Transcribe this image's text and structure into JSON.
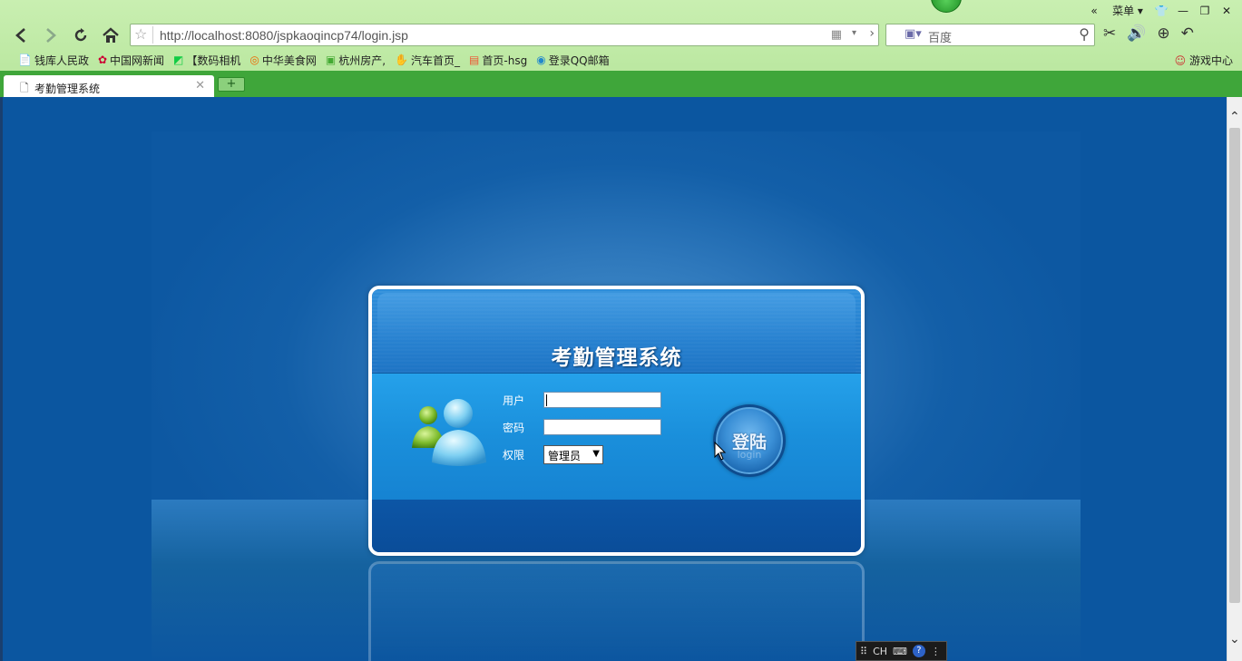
{
  "browser": {
    "menu_label": "菜单",
    "address_url": "http://localhost:8080/jspkaoqincp74/login.jsp",
    "search_placeholder": "百度",
    "bookmarks": [
      {
        "label": "钱库人民政"
      },
      {
        "label": "中国网新闻"
      },
      {
        "label": "【数码相机"
      },
      {
        "label": "中华美食网"
      },
      {
        "label": "杭州房产,"
      },
      {
        "label": "汽车首页_"
      },
      {
        "label": "首页-hsg"
      },
      {
        "label": "登录QQ邮箱"
      }
    ],
    "game_center_label": "游戏中心",
    "tab_title": "考勤管理系统",
    "new_tab_symbol": "+"
  },
  "login": {
    "system_title": "考勤管理系统",
    "user_label": "用户",
    "password_label": "密码",
    "role_label": "权限",
    "role_selected": "管理员",
    "login_button_label": "登陆",
    "login_button_sub": "login"
  },
  "ime": {
    "lang": "CH"
  },
  "colors": {
    "chrome_green": "#b6e59b",
    "tab_bar_green": "#3fa63a",
    "page_blue": "#0b56a0",
    "panel_mid_blue": "#1a8fdb"
  },
  "icons": [
    "back-icon",
    "forward-icon",
    "reload-icon",
    "home-icon",
    "star-icon",
    "qr-icon",
    "search-icon",
    "scissors-icon",
    "speaker-icon",
    "download-icon",
    "undo-icon",
    "users-icon",
    "cursor-icon"
  ]
}
